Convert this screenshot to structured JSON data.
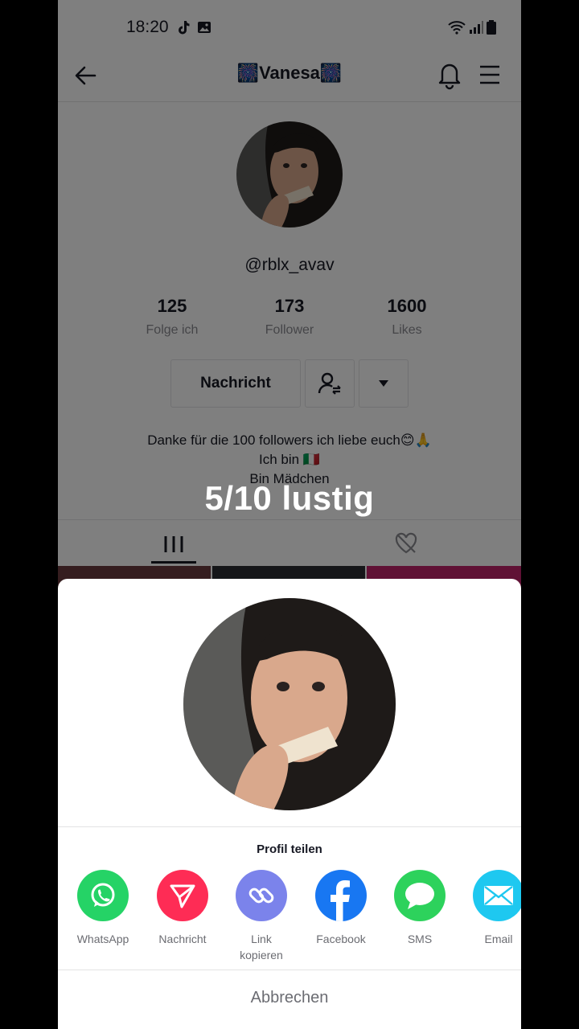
{
  "status_bar": {
    "time": "18:20"
  },
  "header": {
    "title": "🎆Vanesa🎆"
  },
  "profile": {
    "username": "@rblx_avav",
    "stats": [
      {
        "value": "125",
        "label": "Folge ich"
      },
      {
        "value": "173",
        "label": "Follower"
      },
      {
        "value": "1600",
        "label": "Likes"
      }
    ],
    "message_button": "Nachricht",
    "bio": [
      "Danke für die 100 followers ich liebe euch😊🙏",
      "Ich bin 🇮🇹",
      "Bin Mädchen"
    ]
  },
  "video_overlay_text": "5/10 lustig",
  "share_sheet": {
    "title": "Profil teilen",
    "apps": [
      {
        "label": "WhatsApp",
        "icon": "whatsapp-icon",
        "color": "#25d366"
      },
      {
        "label": "Nachricht",
        "icon": "send-icon",
        "color": "#fe2c55"
      },
      {
        "label": "Link kopieren",
        "icon": "link-icon",
        "color": "#7b83eb"
      },
      {
        "label": "Facebook",
        "icon": "facebook-icon",
        "color": "#1877f2"
      },
      {
        "label": "SMS",
        "icon": "sms-icon",
        "color": "#2dd25c"
      },
      {
        "label": "Email",
        "icon": "email-icon",
        "color": "#1ec8f0"
      }
    ],
    "cancel": "Abbrechen"
  }
}
